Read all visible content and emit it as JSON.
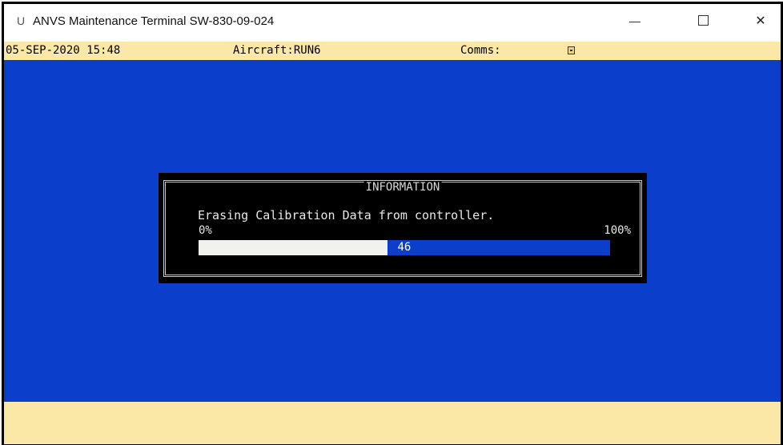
{
  "window": {
    "title": "ANVS Maintenance Terminal SW-830-09-024",
    "app_icon": "U",
    "controls": {
      "minimize_icon": "minimize-icon",
      "maximize_icon": "maximize-icon",
      "close_icon": "close-icon",
      "close_glyph": "✕"
    }
  },
  "status": {
    "date": "05-SEP-2020",
    "time": "15:48",
    "aircraft": "Aircraft:RUN6",
    "comms_label": "Comms:",
    "comms_icon": "comms-status-icon"
  },
  "dialog": {
    "title": "INFORMATION",
    "message": "Erasing Calibration Data from controller.",
    "progress": {
      "min_label": "0%",
      "max_label": "100%",
      "value": 46,
      "value_label": "46"
    }
  },
  "colors": {
    "console_background": "#0b3fcb",
    "status_bar": "#fbe8a6",
    "dialog_background": "#000000",
    "progress_fill": "#f1f1ee"
  }
}
